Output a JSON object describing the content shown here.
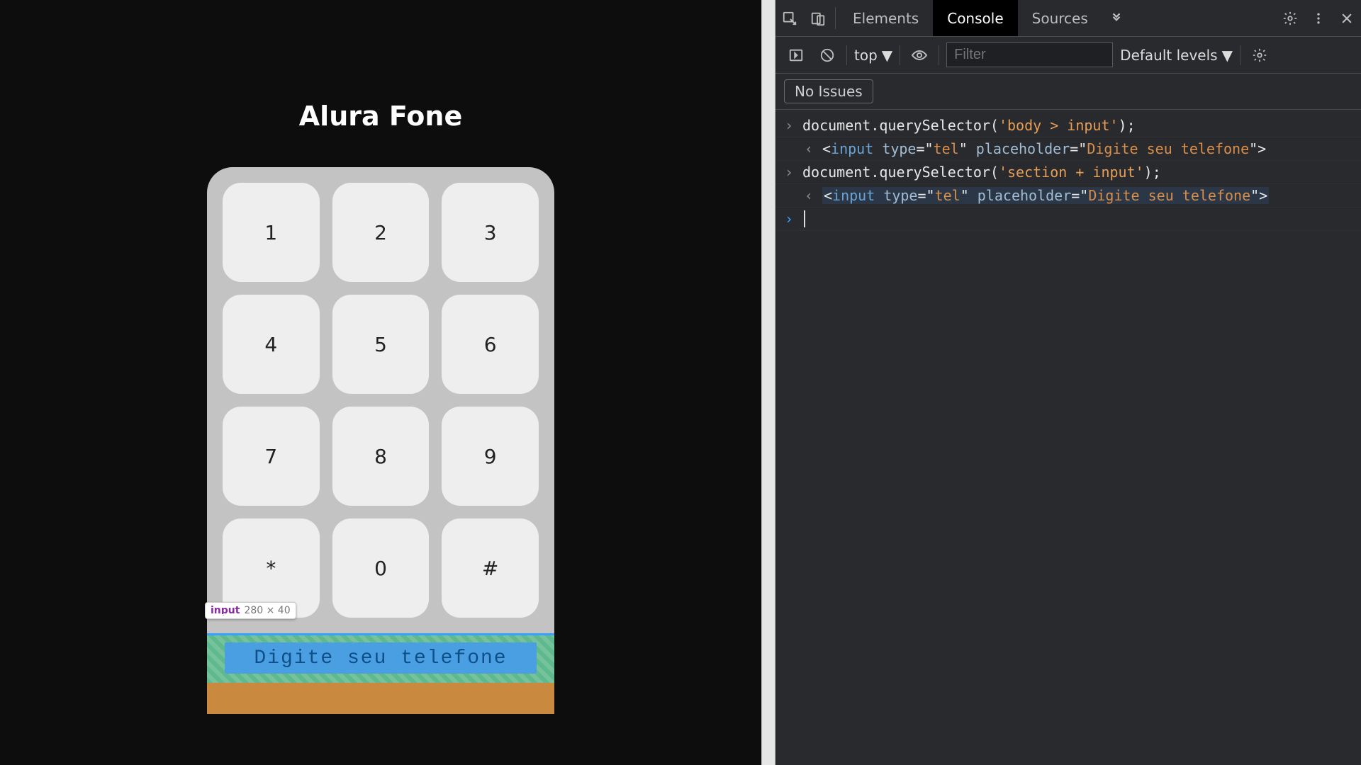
{
  "page": {
    "title": "Alura Fone",
    "keys": [
      "1",
      "2",
      "3",
      "4",
      "5",
      "6",
      "7",
      "8",
      "9",
      "*",
      "0",
      "#"
    ],
    "phone_input_placeholder": "Digite seu telefone",
    "inspect_tooltip": {
      "tag": "input",
      "dimensions": "280 × 40"
    },
    "orange_bar_present": true
  },
  "devtools": {
    "tabs": {
      "elements": "Elements",
      "console": "Console",
      "sources": "Sources",
      "active": "console"
    },
    "toolbar": {
      "context_label": "top",
      "filter_placeholder": "Filter",
      "levels_label": "Default levels"
    },
    "issues_chip": "No Issues",
    "console": {
      "lines": [
        {
          "kind": "input",
          "tokens": [
            "document",
            ".",
            "querySelector",
            "(",
            "'body > input'",
            ")",
            ";"
          ]
        },
        {
          "kind": "result",
          "html_tag": "input",
          "attrs": [
            {
              "name": "type",
              "value": "tel"
            },
            {
              "name": "placeholder",
              "value": "Digite seu telefone"
            }
          ],
          "highlighted": false
        },
        {
          "kind": "input",
          "tokens": [
            "document",
            ".",
            "querySelector",
            "(",
            "'section + input'",
            ")",
            ";"
          ]
        },
        {
          "kind": "result",
          "html_tag": "input",
          "attrs": [
            {
              "name": "type",
              "value": "tel"
            },
            {
              "name": "placeholder",
              "value": "Digite seu telefone"
            }
          ],
          "highlighted": true
        },
        {
          "kind": "prompt"
        }
      ]
    }
  }
}
